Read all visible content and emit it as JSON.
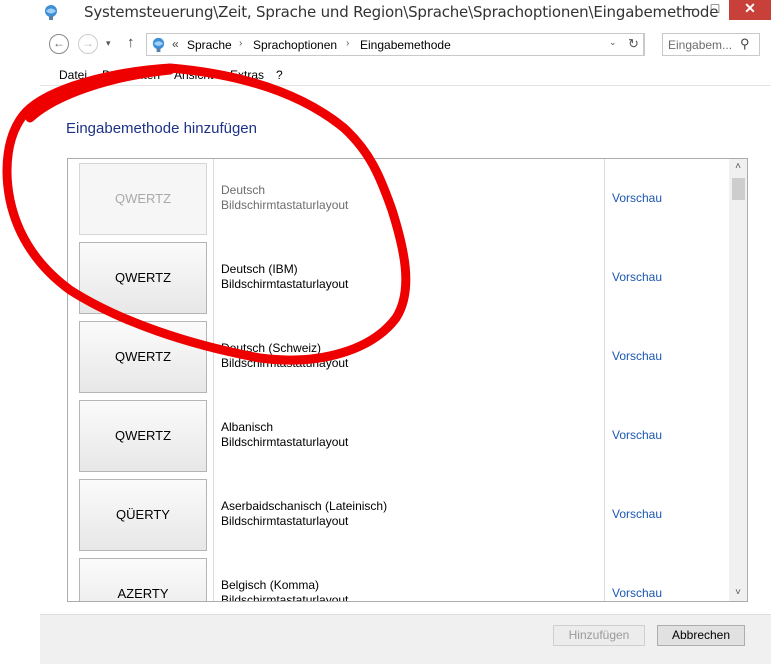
{
  "window": {
    "title": "Systemsteuerung\\Zeit, Sprache und Region\\Sprache\\Sprachoptionen\\Eingabemethode",
    "minimize": "–",
    "maximize": "□",
    "close": "✕"
  },
  "navigation": {
    "back_glyph": "←",
    "forward_glyph": "→",
    "recent_glyph": "▾",
    "up_glyph": "↑",
    "address_chevron": "«",
    "breadcrumbs": [
      "Sprache",
      "Sprachoptionen",
      "Eingabemethode"
    ],
    "breadcrumb_separator": "›",
    "address_dropdown_glyph": "⌄",
    "refresh_glyph": "↻",
    "search_placeholder": "Eingabem...",
    "search_glyph": "⚲"
  },
  "menu": [
    "Datei",
    "Bearbeiten",
    "Ansicht",
    "Extras",
    "?"
  ],
  "heading": "Eingabemethode hinzufügen",
  "input_methods": [
    {
      "layout": "QWERTZ",
      "name": "Deutsch",
      "type": "Bildschirmtastaturlayout",
      "link": "Vorschau",
      "disabled": true
    },
    {
      "layout": "QWERTZ",
      "name": "Deutsch (IBM)",
      "type": "Bildschirmtastaturlayout",
      "link": "Vorschau",
      "disabled": false
    },
    {
      "layout": "QWERTZ",
      "name": "Deutsch (Schweiz)",
      "type": "Bildschirmtastaturlayout",
      "link": "Vorschau",
      "disabled": false
    },
    {
      "layout": "QWERTZ",
      "name": "Albanisch",
      "type": "Bildschirmtastaturlayout",
      "link": "Vorschau",
      "disabled": false
    },
    {
      "layout": "QÜERTY",
      "name": "Aserbaidschanisch (Lateinisch)",
      "type": "Bildschirmtastaturlayout",
      "link": "Vorschau",
      "disabled": false
    },
    {
      "layout": "AZERTY",
      "name": "Belgisch (Komma)",
      "type": "Bildschirmtastaturlayout",
      "link": "Vorschau",
      "disabled": false
    }
  ],
  "scrollbar": {
    "up_glyph": "˄",
    "down_glyph": "˅"
  },
  "buttons": {
    "add": "Hinzufügen",
    "cancel": "Abbrechen"
  },
  "annotation": {
    "color": "#ee0000",
    "shape": "freehand-circle"
  }
}
